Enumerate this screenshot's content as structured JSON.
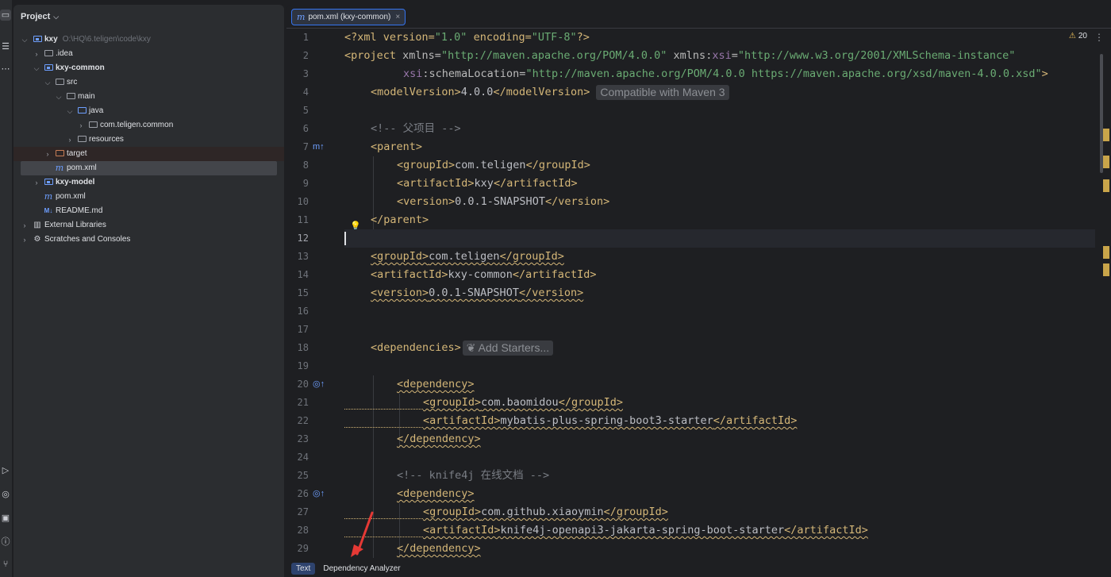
{
  "toolstrip": {
    "icons": [
      "folder-icon",
      "structure-icon",
      "more-icon",
      "run-icon",
      "services-icon",
      "terminal-icon",
      "problems-icon",
      "git-icon"
    ]
  },
  "project": {
    "title": "Project",
    "tree": [
      {
        "label": "kxy",
        "path": "O:\\HQ\\6.teligen\\code\\kxy",
        "icon": "module-folder-icon",
        "expanded": true
      },
      {
        "label": ".idea",
        "icon": "folder-icon",
        "expanded": false
      },
      {
        "label": "kxy-common",
        "icon": "module-folder-icon",
        "expanded": true
      },
      {
        "label": "src",
        "icon": "folder-icon",
        "expanded": true
      },
      {
        "label": "main",
        "icon": "folder-icon",
        "expanded": true
      },
      {
        "label": "java",
        "icon": "source-folder-icon",
        "expanded": true
      },
      {
        "label": "com.teligen.common",
        "icon": "package-icon",
        "expanded": false
      },
      {
        "label": "resources",
        "icon": "resources-folder-icon",
        "expanded": false
      },
      {
        "label": "target",
        "icon": "excluded-folder-icon",
        "expanded": false
      },
      {
        "label": "pom.xml",
        "icon": "maven-icon"
      },
      {
        "label": "kxy-model",
        "icon": "module-folder-icon",
        "expanded": false
      },
      {
        "label": "pom.xml",
        "icon": "maven-icon"
      },
      {
        "label": "README.md",
        "icon": "markdown-icon"
      },
      {
        "label": "External Libraries",
        "icon": "library-icon",
        "expanded": false
      },
      {
        "label": "Scratches and Consoles",
        "icon": "scratches-icon",
        "expanded": false
      }
    ]
  },
  "editor": {
    "tab_label": "pom.xml (kxy-common)",
    "warnings_count": "20",
    "inlay_maven": "Compatible with Maven 3",
    "inlay_starters": "Add Starters...",
    "line_numbers": [
      "1",
      "2",
      "3",
      "4",
      "5",
      "6",
      "7",
      "8",
      "9",
      "10",
      "11",
      "12",
      "13",
      "14",
      "15",
      "16",
      "17",
      "18",
      "19",
      "20",
      "21",
      "22",
      "23",
      "24",
      "25",
      "26",
      "27",
      "28",
      "29"
    ],
    "lines": {
      "l1": {
        "a": "<?xml version=",
        "b": "\"1.0\"",
        "c": " encoding=",
        "d": "\"UTF-8\"",
        "e": "?>"
      },
      "l2": {
        "a": "<project ",
        "b": "xmlns",
        "c": "=",
        "d": "\"http://maven.apache.org/POM/4.0.0\"",
        "e": " xmlns",
        "f": ":",
        "g": "xsi",
        "h": "=",
        "i": "\"http://www.w3.org/2001/XMLSchema-instance\""
      },
      "l3": {
        "a": "xsi",
        "b": ":schemaLocation=",
        "c": "\"http://maven.apache.org/POM/4.0.0 https://maven.apache.org/xsd/maven-4.0.0.xsd\"",
        "d": ">"
      },
      "l4": {
        "a": "<modelVersion>",
        "b": "4.0.0",
        "c": "</modelVersion>"
      },
      "l6": "<!-- 父项目 -->",
      "l7": "<parent>",
      "l8": {
        "a": "<groupId>",
        "b": "com.teligen",
        "c": "</groupId>"
      },
      "l9": {
        "a": "<artifactId>",
        "b": "kxy",
        "c": "</artifactId>"
      },
      "l10": {
        "a": "<version>",
        "b": "0.0.1-SNAPSHOT",
        "c": "</version>"
      },
      "l11": "</parent>",
      "l13": {
        "a": "<groupId>",
        "b": "com.teligen",
        "c": "</groupId>"
      },
      "l14": {
        "a": "<artifactId>",
        "b": "kxy-common",
        "c": "</artifactId>"
      },
      "l15": {
        "a": "<version>",
        "b": "0.0.1-SNAPSHOT",
        "c": "</version>"
      },
      "l18": "<dependencies>",
      "l20": "<dependency>",
      "l21": {
        "a": "<groupId>",
        "b": "com.baomidou",
        "c": "</groupId>"
      },
      "l22": {
        "a": "<artifactId>",
        "b": "mybatis-plus-spring-boot3-starter",
        "c": "</artifactId>"
      },
      "l23": "</dependency>",
      "l25": "<!-- knife4j 在线文档 -->",
      "l26": "<dependency>",
      "l27": {
        "a": "<groupId>",
        "b": "com.github.xiaoymin",
        "c": "</groupId>"
      },
      "l28": {
        "a": "<artifactId>",
        "b": "knife4j-openapi3-jakarta-spring-boot-starter",
        "c": "</artifactId>"
      },
      "l29": "</dependency>"
    }
  },
  "bottom_tabs": {
    "text": "Text",
    "dependency_analyzer": "Dependency Analyzer"
  },
  "colors": {
    "tag": "#d5b778",
    "string": "#6aab73",
    "comment": "#7a7e85",
    "accent": "#3574f0",
    "annotation_arrow": "#e53935"
  }
}
